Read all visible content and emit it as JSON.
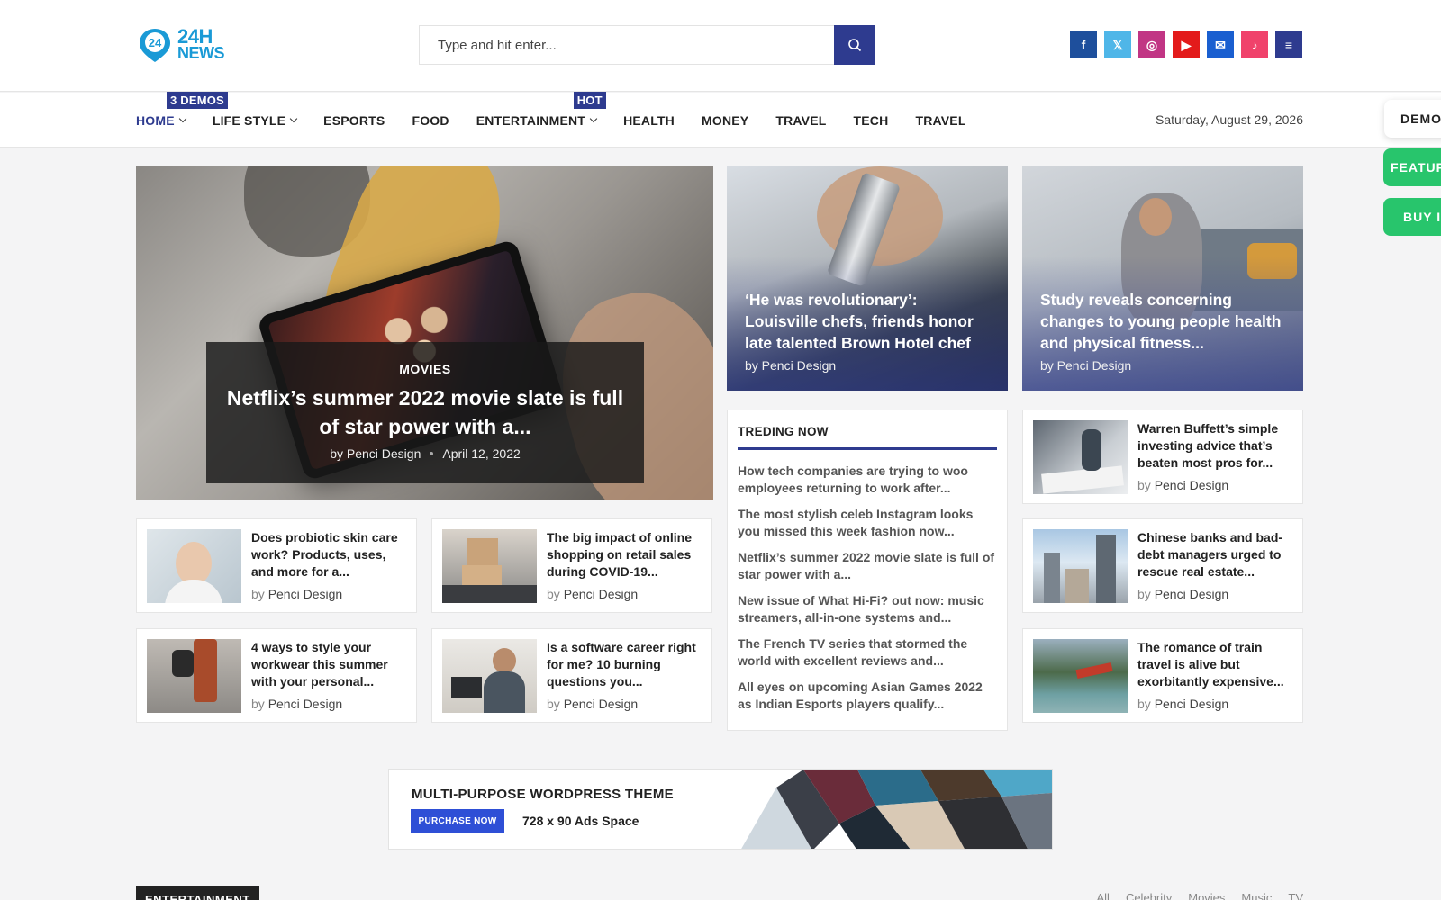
{
  "header": {
    "logo": {
      "badge": "24",
      "line1": "24H",
      "line2": "NEWS"
    },
    "search": {
      "placeholder": "Type and hit enter..."
    },
    "socials": [
      {
        "name": "facebook",
        "glyph": "f",
        "color": "#1e4f9c"
      },
      {
        "name": "x",
        "glyph": "𝕏",
        "color": "#4fb6e8"
      },
      {
        "name": "instagram",
        "glyph": "◎",
        "color": "#c13584"
      },
      {
        "name": "youtube",
        "glyph": "▶",
        "color": "#e31b1b"
      },
      {
        "name": "email",
        "glyph": "✉",
        "color": "#1a5fd0"
      },
      {
        "name": "tiktok",
        "glyph": "♪",
        "color": "#f0426b"
      },
      {
        "name": "menu",
        "glyph": "≡",
        "color": "#2e3b8f"
      }
    ]
  },
  "nav": {
    "items": [
      {
        "label": "HOME",
        "badge": "3 DEMOS"
      },
      {
        "label": "LIFE STYLE"
      },
      {
        "label": "ESPORTS"
      },
      {
        "label": "FOOD"
      },
      {
        "label": "ENTERTAINMENT",
        "badge": "HOT"
      },
      {
        "label": "HEALTH"
      },
      {
        "label": "MONEY"
      },
      {
        "label": "TRAVEL"
      },
      {
        "label": "TECH"
      },
      {
        "label": "TRAVEL"
      }
    ],
    "date": "Saturday, August 29, 2026"
  },
  "side_buttons": {
    "demo": "DEMO",
    "features": "FEATUR",
    "buy": "BUY I"
  },
  "hero": {
    "category": "MOVIES",
    "title": "Netflix’s summer 2022 movie slate is full of star power with a...",
    "author": "by Penci Design",
    "date": "April 12, 2022"
  },
  "featured": [
    {
      "title": "‘He was revolutionary’: Louisville chefs, friends honor late talented Brown Hotel chef",
      "author": "by Penci Design"
    },
    {
      "title": "Study reveals concerning changes to young people health and physical fitness...",
      "author": "by Penci Design"
    }
  ],
  "cards": [
    {
      "title": "Does probiotic skin care work? Products, uses, and more for a...",
      "by": "by",
      "author": "Penci Design"
    },
    {
      "title": "The big impact of online shopping on retail sales during COVID-19...",
      "by": "by",
      "author": "Penci Design"
    },
    {
      "title": "4 ways to style your workwear this summer with your personal...",
      "by": "by",
      "author": "Penci Design"
    },
    {
      "title": "Is a software career right for me? 10 burning questions you...",
      "by": "by",
      "author": "Penci Design"
    },
    {
      "title": "Warren Buffett’s simple investing advice that’s beaten most pros for...",
      "by": "by",
      "author": "Penci Design"
    },
    {
      "title": "Chinese banks and bad-debt managers urged to rescue real estate...",
      "by": "by",
      "author": "Penci Design"
    },
    {
      "title": "The romance of train travel is alive but exorbitantly expensive...",
      "by": "by",
      "author": "Penci Design"
    }
  ],
  "trending": {
    "heading": "TREDING NOW",
    "items": [
      "How tech companies are trying to woo employees returning to work after...",
      "The most stylish celeb Instagram looks you missed this week fashion now...",
      "Netflix’s summer 2022 movie slate is full of star power with a...",
      "New issue of What Hi-Fi? out now: music streamers, all-in-one systems and...",
      "The French TV series that stormed the world with excellent reviews and...",
      "All eyes on upcoming Asian Games 2022 as Indian Esports players qualify..."
    ]
  },
  "ad": {
    "title": "MULTI-PURPOSE WORDPRESS THEME",
    "button": "PURCHASE NOW",
    "size": "728 x 90 Ads Space"
  },
  "section": {
    "title": "ENTERTAINMENT",
    "tabs": [
      "All",
      "Celebrity",
      "Movies",
      "Music",
      "TV"
    ]
  },
  "colors": {
    "accent": "#2e3b8f",
    "green": "#28c56c"
  }
}
